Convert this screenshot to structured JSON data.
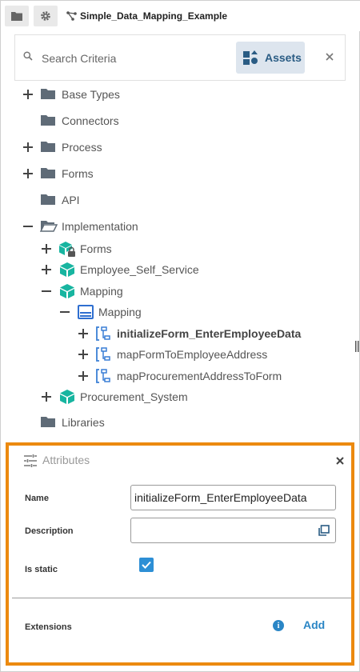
{
  "topbar": {
    "project_title": "Simple_Data_Mapping_Example"
  },
  "search": {
    "placeholder": "Search Criteria",
    "assets_label": "Assets"
  },
  "tree": {
    "base_types": "Base Types",
    "connectors": "Connectors",
    "process": "Process",
    "forms": "Forms",
    "api": "API",
    "implementation": "Implementation",
    "impl_forms": "Forms",
    "employee_self_service": "Employee_Self_Service",
    "mapping_module": "Mapping",
    "mapping_class": "Mapping",
    "method_1": "initializeForm_EnterEmployeeData",
    "method_2": "mapFormToEmployeeAddress",
    "method_3": "mapProcurementAddressToForm",
    "procurement_system": "Procurement_System",
    "libraries": "Libraries"
  },
  "attributes": {
    "title": "Attributes",
    "name_label": "Name",
    "name_value": "initializeForm_EnterEmployeeData",
    "description_label": "Description",
    "description_value": "",
    "is_static_label": "Is static",
    "is_static": true,
    "extensions_label": "Extensions",
    "info_glyph": "i",
    "add_label": "Add"
  },
  "colors": {
    "folder": "#5f6b77",
    "module_teal": "#17b5a0",
    "class_blue": "#2f6fd0",
    "method_blue": "#3a7fd5",
    "selection_orange": "#ec8a0f",
    "link_blue": "#2b86c5",
    "checkbox_blue": "#2d8fd5"
  }
}
